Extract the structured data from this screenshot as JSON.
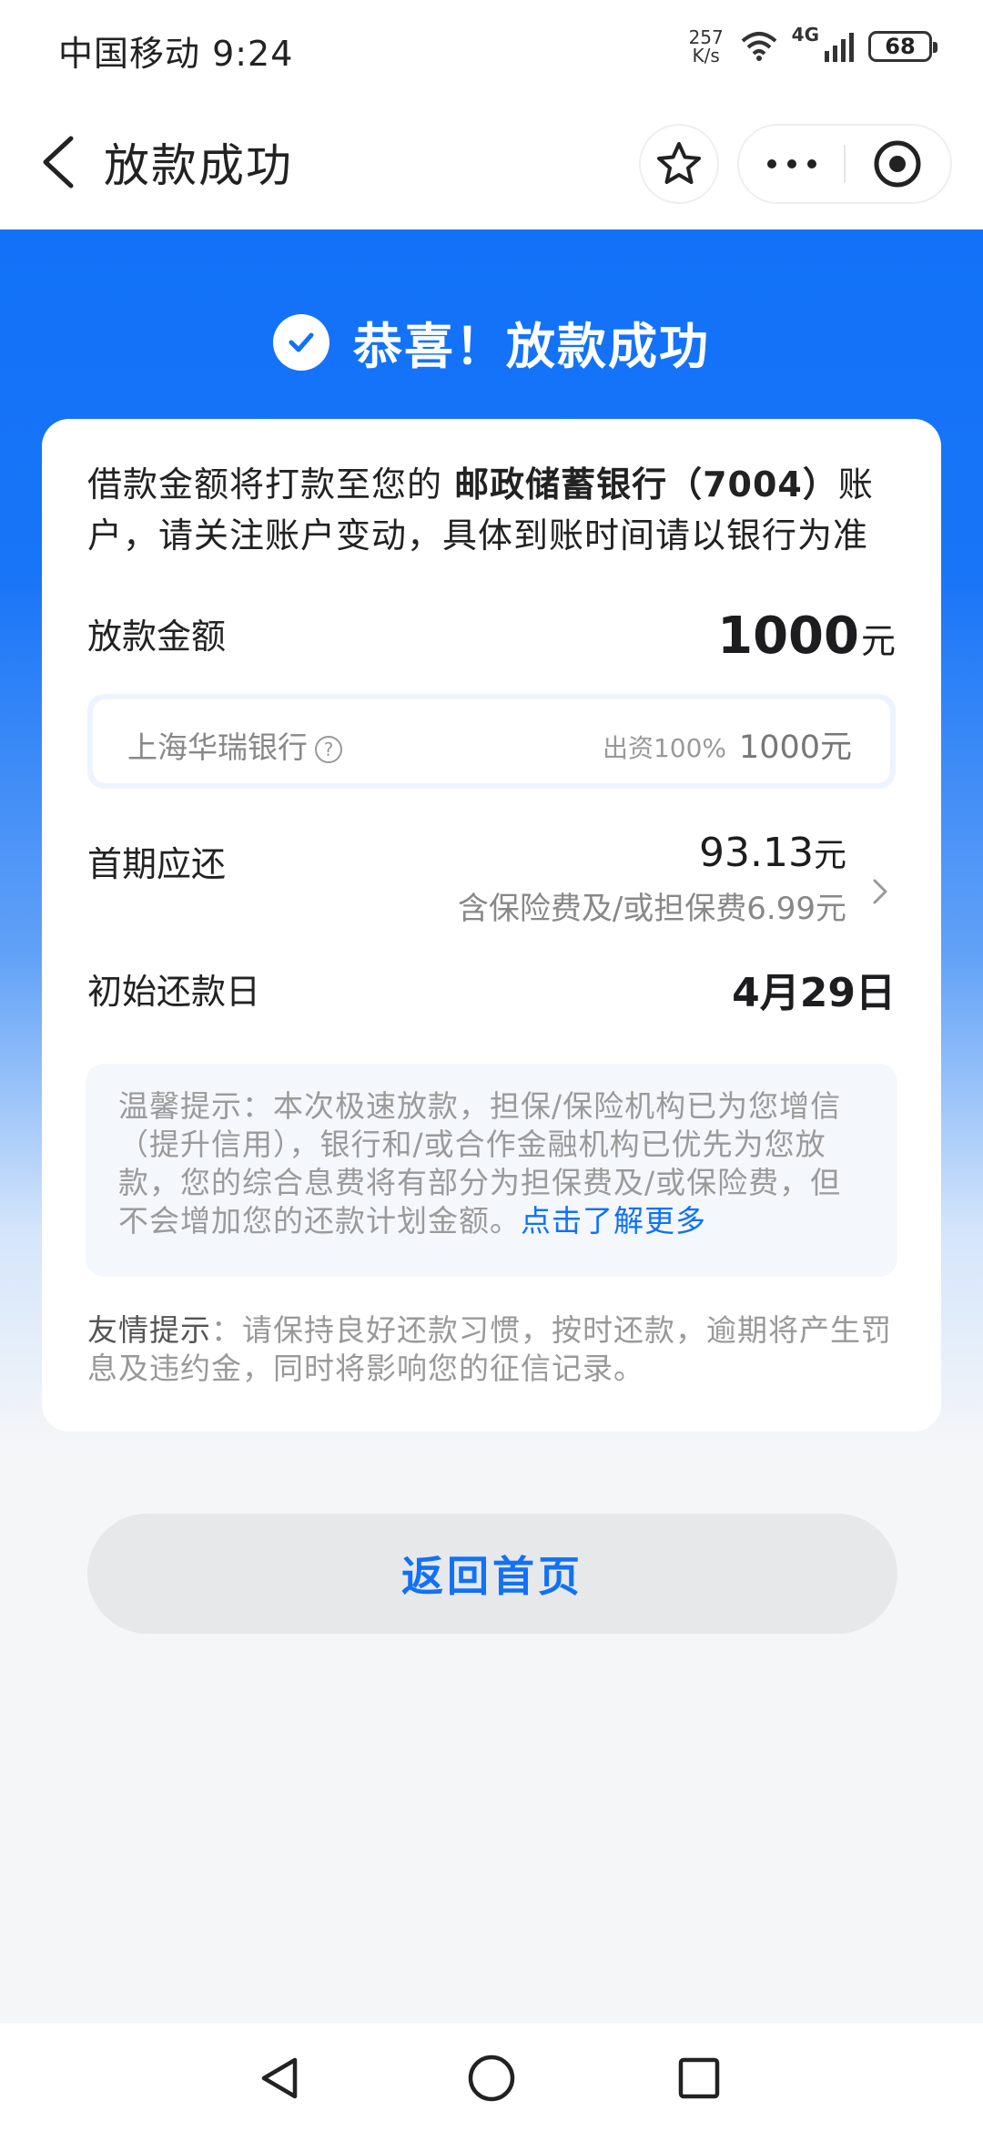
{
  "status_bar": {
    "carrier_time": "中国移动 9:24",
    "net_speed_value": "257",
    "net_speed_unit": "K/s",
    "network": "4G",
    "battery": "68"
  },
  "header": {
    "title": "放款成功"
  },
  "banner": {
    "title": "恭喜！放款成功"
  },
  "card": {
    "notice_prefix": "借款金额将打款至您的 ",
    "notice_bank": "邮政储蓄银行（7004）",
    "notice_suffix": "账户，请关注账户变动，具体到账时间请以银行为准",
    "loan_amount_label": "放款金额",
    "loan_amount_value": "1000",
    "loan_amount_unit": "元",
    "funder_name": "上海华瑞银行",
    "funder_help": "?",
    "funder_share": "出资100%",
    "funder_amount": "1000元",
    "first_repay_label": "首期应还",
    "first_repay_value": "93.13",
    "first_repay_unit": "元",
    "first_repay_fee": "含保险费及/或担保费6.99元",
    "start_date_label": "初始还款日",
    "start_date_value": "4月29日",
    "tip_text": "温馨提示：本次极速放款，担保/保险机构已为您增信（提升信用），银行和/或合作金融机构已优先为您放款，您的综合息费将有部分为担保费及/或保险费，但不会增加您的还款计划金额。",
    "tip_link": "点击了解更多",
    "friendly_label": "友情提示",
    "friendly_text": "：请保持良好还款习惯，按时还款，逾期将产生罚息及违约金，同时将影响您的征信记录。"
  },
  "actions": {
    "home_button": "返回首页"
  },
  "colors": {
    "brand_blue": "#1171f8"
  }
}
